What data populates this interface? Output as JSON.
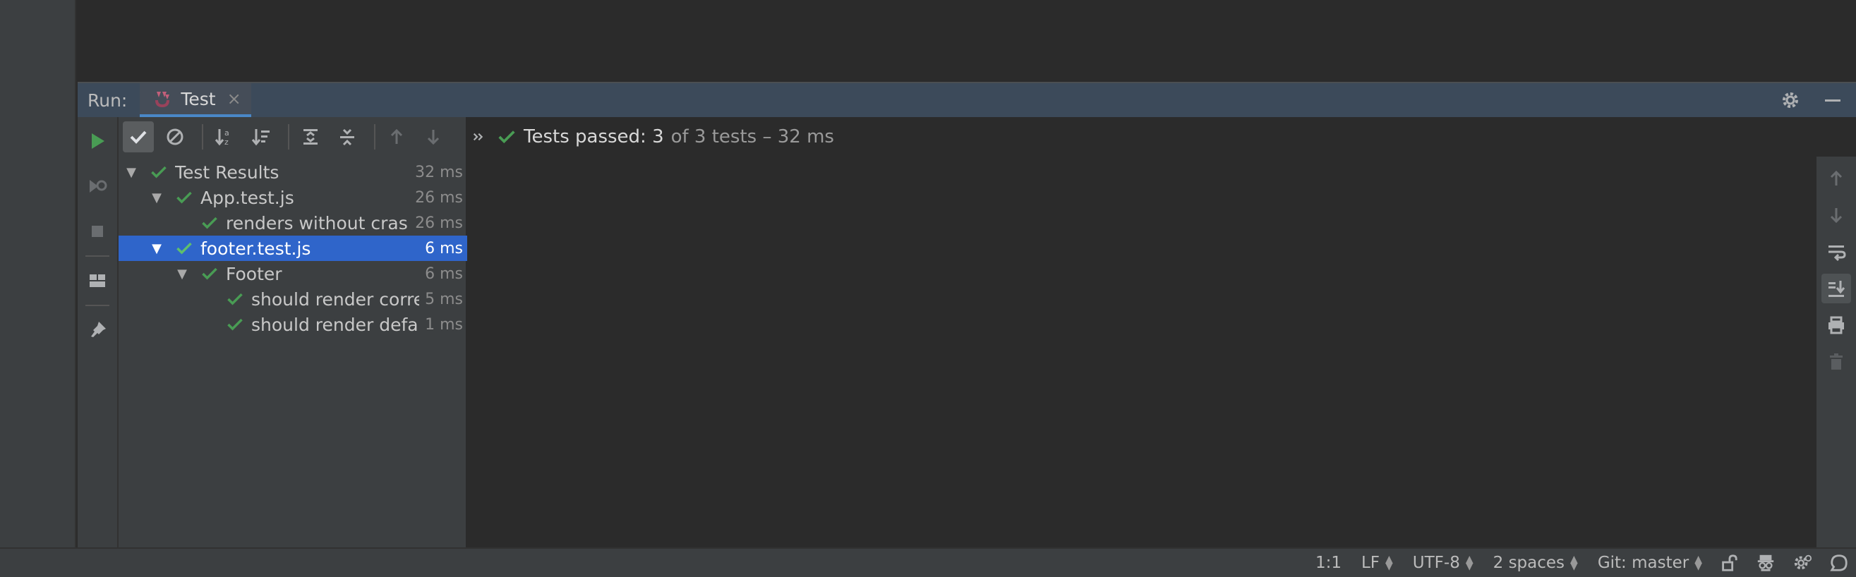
{
  "run_panel": {
    "label": "Run:",
    "tab": {
      "label": "Test",
      "close": "×"
    }
  },
  "status": {
    "summary": "Tests passed: 3",
    "detail": "of 3 tests – 32 ms"
  },
  "tree": [
    {
      "label": "Test Results",
      "time": "32 ms",
      "level": 0,
      "expanded": true,
      "selected": false
    },
    {
      "label": "App.test.js",
      "time": "26 ms",
      "level": 1,
      "expanded": true,
      "selected": false
    },
    {
      "label": "renders without cras",
      "time": "26 ms",
      "level": 2,
      "expanded": false,
      "selected": false
    },
    {
      "label": "footer.test.js",
      "time": "6 ms",
      "level": 1,
      "expanded": true,
      "selected": true
    },
    {
      "label": "Footer",
      "time": "6 ms",
      "level": 2,
      "expanded": true,
      "selected": false
    },
    {
      "label": "should render corre",
      "time": "5 ms",
      "level": 3,
      "expanded": false,
      "selected": false
    },
    {
      "label": "should render defau",
      "time": "1 ms",
      "level": 3,
      "expanded": false,
      "selected": false
    }
  ],
  "statusbar": {
    "position": "1:1",
    "line_separator": "LF",
    "encoding": "UTF-8",
    "indent": "2 spaces",
    "vcs": "Git: master"
  },
  "colors": {
    "pass_green": "#499c54",
    "selection_blue": "#2f65ca",
    "run_green": "#499c54"
  },
  "icons": {
    "run": "play-icon",
    "rerun_failed": "rerun-failed-icon",
    "stop": "stop-icon",
    "layout": "layout-icon",
    "pin": "pin-icon",
    "show_passed": "check-icon",
    "show_ignored": "ignored-icon",
    "sort_alpha": "sort-alphabetically-icon",
    "sort_duration": "sort-duration-icon",
    "expand_all": "expand-all-icon",
    "collapse_all": "collapse-all-icon",
    "prev_failed": "arrow-up-icon",
    "next_failed": "arrow-down-icon",
    "more": "more-icon",
    "settings": "gear-icon",
    "minimize": "minimize-icon"
  }
}
